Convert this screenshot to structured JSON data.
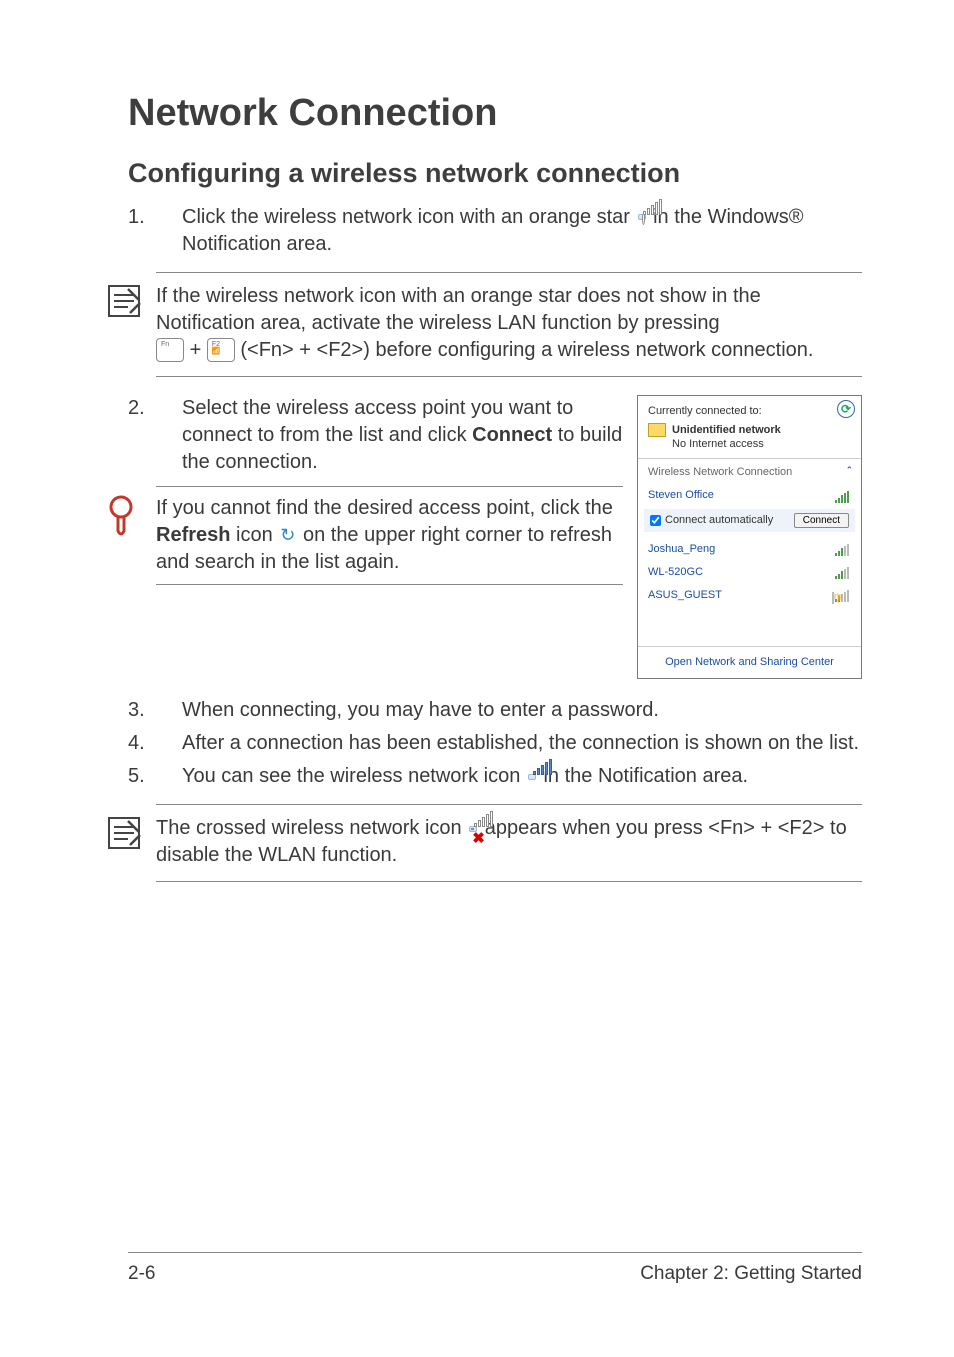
{
  "title": "Network Connection",
  "subtitle": "Configuring a wireless network connection",
  "steps": {
    "s1": {
      "num": "1.",
      "text_before_icon": "Click the wireless network icon with an orange star ",
      "text_after_icon": " in the Windows® Notification area."
    },
    "s2": {
      "num": "2.",
      "text_a": "Select the wireless access point you want to connect to from the list and click ",
      "bold": "Connect",
      "text_b": " to build the connection."
    },
    "s3": {
      "num": "3.",
      "text": "When connecting, you may have to enter a password."
    },
    "s4": {
      "num": "4.",
      "text": "After a connection has been established, the connection is shown on the list."
    },
    "s5": {
      "num": "5.",
      "text_before": "You can see the wireless network icon ",
      "text_after": " in the Notification area."
    }
  },
  "note1": {
    "line1": "If the wireless network icon with an orange star does not show in the Notification area, activate the wireless LAN function by pressing",
    "plus": " + ",
    "key1": "Fn",
    "key2_top": "F2",
    "after_keys": " (<Fn> + <F2>) before configuring a wireless network connection."
  },
  "tip": {
    "t1": "If you cannot find the desired access point, click the ",
    "bold": "Refresh",
    "t2": " icon ",
    "t3": " on the upper right corner to refresh and search in the list again."
  },
  "note2": {
    "before": "The crossed wireless network icon ",
    "after": " appears when you press <Fn> + <F2> to disable the WLAN function."
  },
  "popup": {
    "currently": "Currently connected to:",
    "net_name": "Unidentified network",
    "net_status": "No Internet access",
    "section": "Wireless Network Connection",
    "caret": "ˆ",
    "items": [
      {
        "name": "Steven Office"
      },
      {
        "name": "Joshua_Peng"
      },
      {
        "name": "WL-520GC"
      },
      {
        "name": "ASUS_GUEST"
      }
    ],
    "auto": "Connect automatically",
    "connect_btn": "Connect",
    "footer": "Open Network and Sharing Center",
    "refresh_glyph": "⟳"
  },
  "footer": {
    "left": "2-6",
    "right": "Chapter 2: Getting Started"
  }
}
